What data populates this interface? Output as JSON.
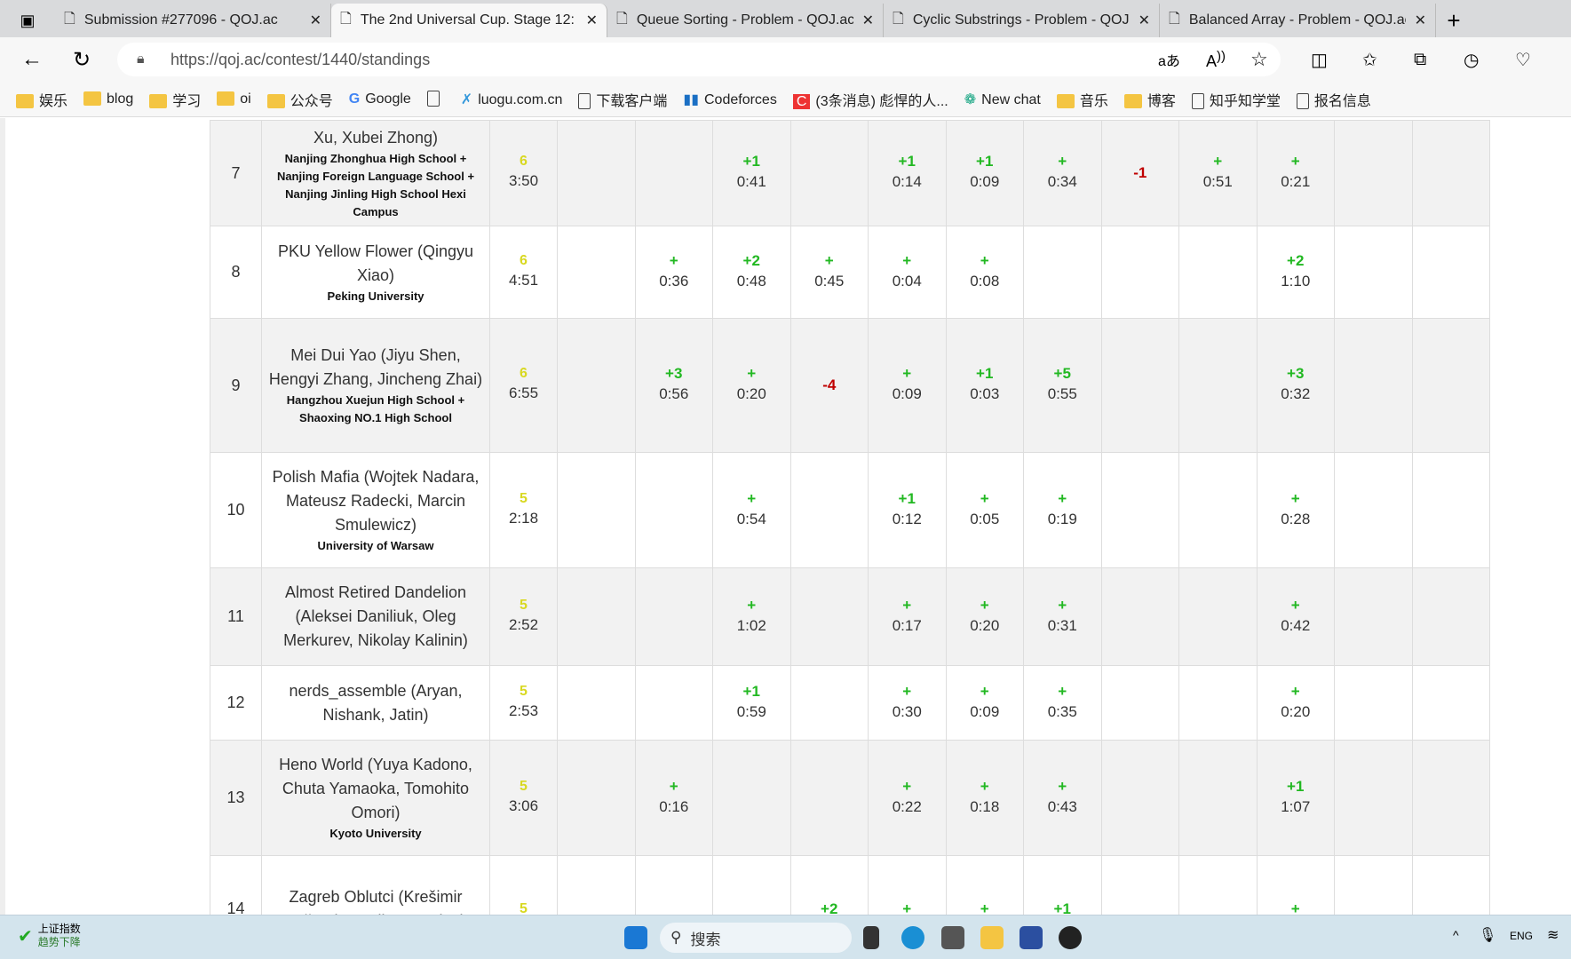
{
  "tabs": [
    {
      "title": "Submission #277096 - QOJ.ac",
      "active": false
    },
    {
      "title": "The 2nd Universal Cup. Stage 12:",
      "active": true
    },
    {
      "title": "Queue Sorting - Problem - QOJ.ac",
      "active": false
    },
    {
      "title": "Cyclic Substrings - Problem - QOJ",
      "active": false
    },
    {
      "title": "Balanced Array - Problem - QOJ.ac",
      "active": false
    }
  ],
  "address": {
    "url": "https://qoj.ac/contest/1440/standings"
  },
  "bookmarks": [
    {
      "label": "娱乐",
      "icon": "folder-icon"
    },
    {
      "label": "blog",
      "icon": "folder-icon"
    },
    {
      "label": "学习",
      "icon": "folder-icon"
    },
    {
      "label": "oi",
      "icon": "folder-icon"
    },
    {
      "label": "公众号",
      "icon": "folder-icon"
    },
    {
      "label": "Google",
      "icon": "google-icon"
    },
    {
      "label": "",
      "icon": "page-icon"
    },
    {
      "label": "luogu.com.cn",
      "icon": "luogu-icon"
    },
    {
      "label": "下载客户端",
      "icon": "page-icon"
    },
    {
      "label": "Codeforces",
      "icon": "codeforces-icon"
    },
    {
      "label": "(3条消息) 彪悍的人...",
      "icon": "csdn-icon"
    },
    {
      "label": "New chat",
      "icon": "chatgpt-icon"
    },
    {
      "label": "音乐",
      "icon": "folder-icon"
    },
    {
      "label": "博客",
      "icon": "folder-icon"
    },
    {
      "label": "知乎知学堂",
      "icon": "page-icon"
    },
    {
      "label": "报名信息",
      "icon": "page-icon"
    }
  ],
  "colors": {
    "accepted": "#22b822",
    "rejected": "#c00000",
    "score": "#d8d820"
  },
  "standings": [
    {
      "rank": "7",
      "team": "Xu, Xubei Zhong)",
      "affiliation": "Nanjing Zhonghua High School + Nanjing Foreign Language School + Nanjing Jinling High School Hexi Campus",
      "score": "6",
      "penalty": "3:50",
      "problems": [
        [
          "",
          ""
        ],
        [
          "",
          ""
        ],
        [
          "+1",
          "0:41"
        ],
        [
          "",
          ""
        ],
        [
          "+1",
          "0:14"
        ],
        [
          "+1",
          "0:09"
        ],
        [
          "+",
          "0:34"
        ],
        [
          "-1",
          ""
        ],
        [
          "+",
          "0:51"
        ],
        [
          "+",
          "0:21"
        ],
        [
          "",
          ""
        ],
        [
          "",
          ""
        ]
      ]
    },
    {
      "rank": "8",
      "team": "PKU Yellow Flower (Qingyu Xiao)",
      "affiliation": "Peking University",
      "score": "6",
      "penalty": "4:51",
      "problems": [
        [
          "",
          ""
        ],
        [
          "+",
          "0:36"
        ],
        [
          "+2",
          "0:48"
        ],
        [
          "+",
          "0:45"
        ],
        [
          "+",
          "0:04"
        ],
        [
          "+",
          "0:08"
        ],
        [
          "",
          ""
        ],
        [
          "",
          ""
        ],
        [
          "",
          ""
        ],
        [
          "+2",
          "1:10"
        ],
        [
          "",
          ""
        ],
        [
          "",
          ""
        ]
      ]
    },
    {
      "rank": "9",
      "team": "Mei Dui Yao (Jiyu Shen, Hengyi Zhang, Jincheng Zhai)",
      "affiliation": "Hangzhou Xuejun High School + Shaoxing NO.1 High School",
      "score": "6",
      "penalty": "6:55",
      "problems": [
        [
          "",
          ""
        ],
        [
          "+3",
          "0:56"
        ],
        [
          "+",
          "0:20"
        ],
        [
          "-4",
          ""
        ],
        [
          "+",
          "0:09"
        ],
        [
          "+1",
          "0:03"
        ],
        [
          "+5",
          "0:55"
        ],
        [
          "",
          ""
        ],
        [
          "",
          ""
        ],
        [
          "+3",
          "0:32"
        ],
        [
          "",
          ""
        ],
        [
          "",
          ""
        ]
      ]
    },
    {
      "rank": "10",
      "team": "Polish Mafia (Wojtek Nadara, Mateusz Radecki, Marcin Smulewicz)",
      "affiliation": "University of Warsaw",
      "score": "5",
      "penalty": "2:18",
      "problems": [
        [
          "",
          ""
        ],
        [
          "",
          ""
        ],
        [
          "+",
          "0:54"
        ],
        [
          "",
          ""
        ],
        [
          "+1",
          "0:12"
        ],
        [
          "+",
          "0:05"
        ],
        [
          "+",
          "0:19"
        ],
        [
          "",
          ""
        ],
        [
          "",
          ""
        ],
        [
          "+",
          "0:28"
        ],
        [
          "",
          ""
        ],
        [
          "",
          ""
        ]
      ]
    },
    {
      "rank": "11",
      "team": "Almost Retired Dandelion (Aleksei Daniliuk, Oleg Merkurev, Nikolay Kalinin)",
      "affiliation": "",
      "score": "5",
      "penalty": "2:52",
      "problems": [
        [
          "",
          ""
        ],
        [
          "",
          ""
        ],
        [
          "+",
          "1:02"
        ],
        [
          "",
          ""
        ],
        [
          "+",
          "0:17"
        ],
        [
          "+",
          "0:20"
        ],
        [
          "+",
          "0:31"
        ],
        [
          "",
          ""
        ],
        [
          "",
          ""
        ],
        [
          "+",
          "0:42"
        ],
        [
          "",
          ""
        ],
        [
          "",
          ""
        ]
      ]
    },
    {
      "rank": "12",
      "team": "nerds_assemble (Aryan, Nishank, Jatin)",
      "affiliation": "",
      "score": "5",
      "penalty": "2:53",
      "problems": [
        [
          "",
          ""
        ],
        [
          "",
          ""
        ],
        [
          "+1",
          "0:59"
        ],
        [
          "",
          ""
        ],
        [
          "+",
          "0:30"
        ],
        [
          "+",
          "0:09"
        ],
        [
          "+",
          "0:35"
        ],
        [
          "",
          ""
        ],
        [
          "",
          ""
        ],
        [
          "+",
          "0:20"
        ],
        [
          "",
          ""
        ],
        [
          "",
          ""
        ]
      ]
    },
    {
      "rank": "13",
      "team": "Heno World (Yuya Kadono, Chuta Yamaoka, Tomohito Omori)",
      "affiliation": "Kyoto University",
      "score": "5",
      "penalty": "3:06",
      "problems": [
        [
          "",
          ""
        ],
        [
          "+",
          "0:16"
        ],
        [
          "",
          ""
        ],
        [
          "",
          ""
        ],
        [
          "+",
          "0:22"
        ],
        [
          "+",
          "0:18"
        ],
        [
          "+",
          "0:43"
        ],
        [
          "",
          ""
        ],
        [
          "",
          ""
        ],
        [
          "+1",
          "1:07"
        ],
        [
          "",
          ""
        ],
        [
          "",
          ""
        ]
      ]
    },
    {
      "rank": "14",
      "team": "Zagreb Oblutci (Krešimir Nežmah, Dorijan Lendvaj,",
      "affiliation": "",
      "score": "5",
      "penalty": "",
      "problems": [
        [
          "",
          ""
        ],
        [
          "",
          ""
        ],
        [
          "",
          ""
        ],
        [
          "+2",
          ""
        ],
        [
          "+",
          ""
        ],
        [
          "+",
          ""
        ],
        [
          "+1",
          ""
        ],
        [
          "",
          ""
        ],
        [
          "",
          ""
        ],
        [
          "+",
          ""
        ],
        [
          "",
          ""
        ],
        [
          "",
          ""
        ]
      ]
    }
  ],
  "taskbar": {
    "stock_title": "上证指数",
    "stock_status": "趋势下降",
    "search_placeholder": "搜索",
    "lang": "ENG"
  }
}
